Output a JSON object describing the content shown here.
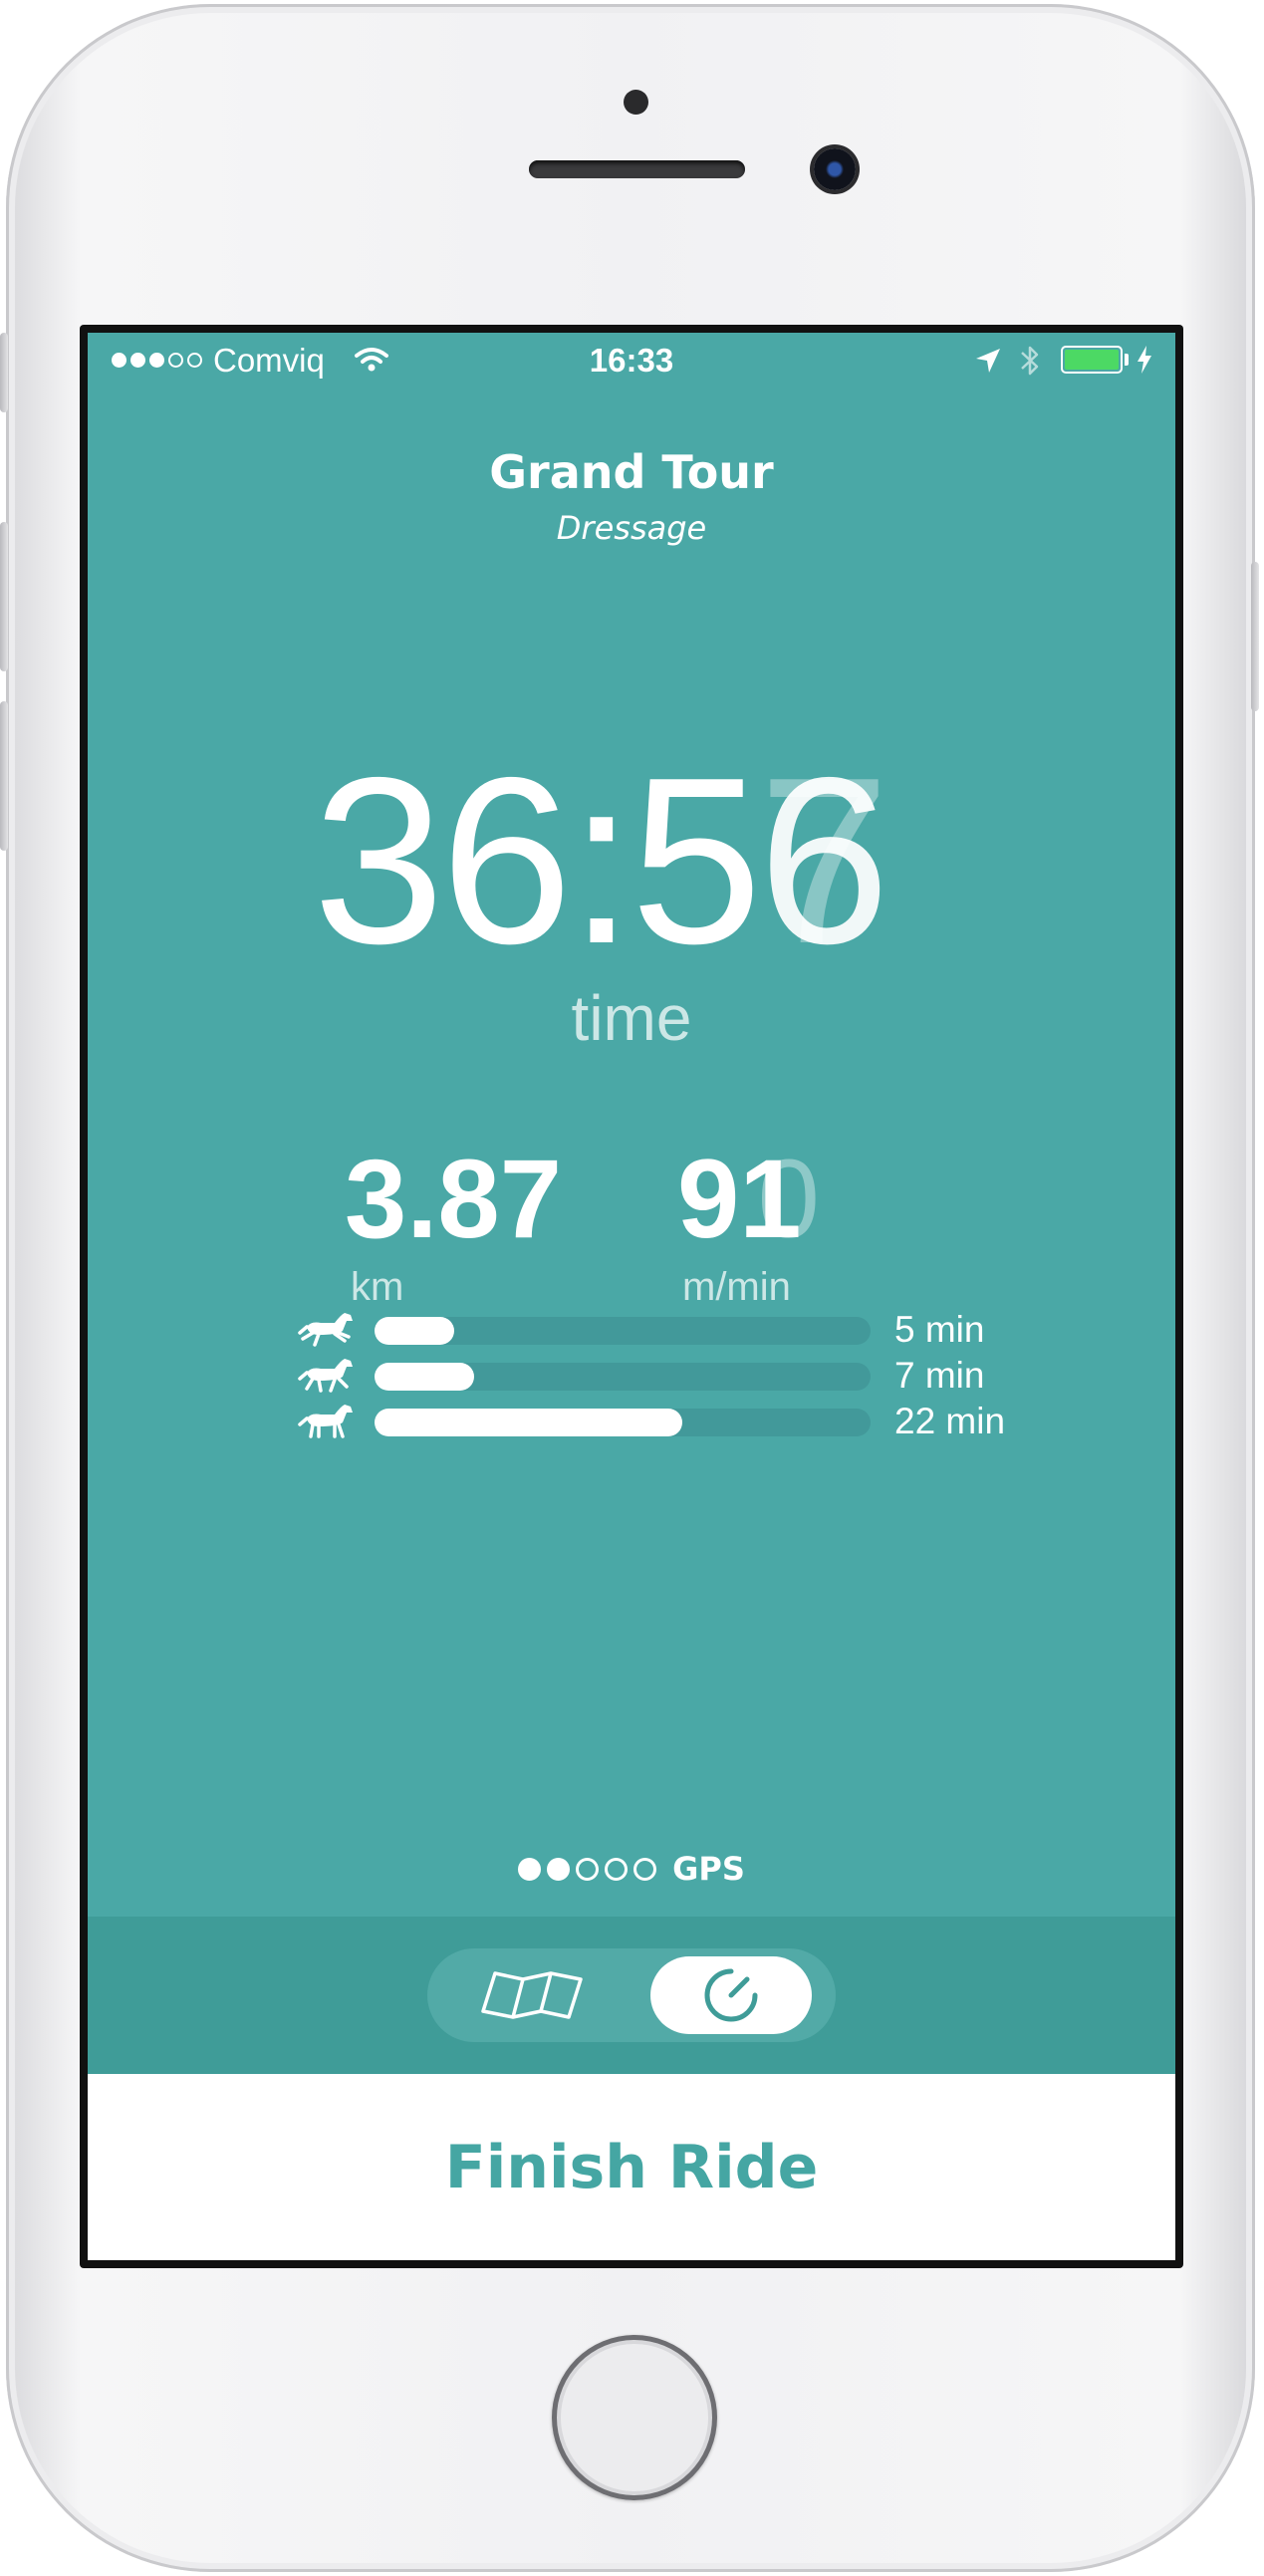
{
  "status_bar": {
    "carrier": "Comviq",
    "time": "16:33",
    "signal_bars_filled": 3,
    "signal_bars_total": 5,
    "battery_color": "#4cd964"
  },
  "ride": {
    "title": "Grand Tour",
    "subtitle": "Dressage"
  },
  "timer": {
    "main": "36:5",
    "digit_previous": "7",
    "digit_current": "6",
    "label": "time"
  },
  "stats": {
    "distance": {
      "value": "3.87",
      "unit": "km"
    },
    "speed": {
      "value": "91",
      "ghost_digit": "0",
      "unit": "m/min"
    }
  },
  "gaits": [
    {
      "icon": "horse-gallop-icon",
      "label": "5 min",
      "fraction": 0.16
    },
    {
      "icon": "horse-trot-icon",
      "label": "7 min",
      "fraction": 0.2
    },
    {
      "icon": "horse-walk-icon",
      "label": "22 min",
      "fraction": 0.62
    }
  ],
  "gps": {
    "label": "GPS",
    "strength_filled": 2,
    "strength_total": 5
  },
  "view_toggle": {
    "options": [
      "map-icon",
      "speedometer-icon"
    ],
    "selected": "speedometer-icon"
  },
  "finish": {
    "label": "Finish Ride"
  },
  "colors": {
    "background": "#4aa8a6",
    "toggle_bar": "#3f9c98",
    "accent_text": "#45a6a3",
    "track": "#42999a"
  }
}
